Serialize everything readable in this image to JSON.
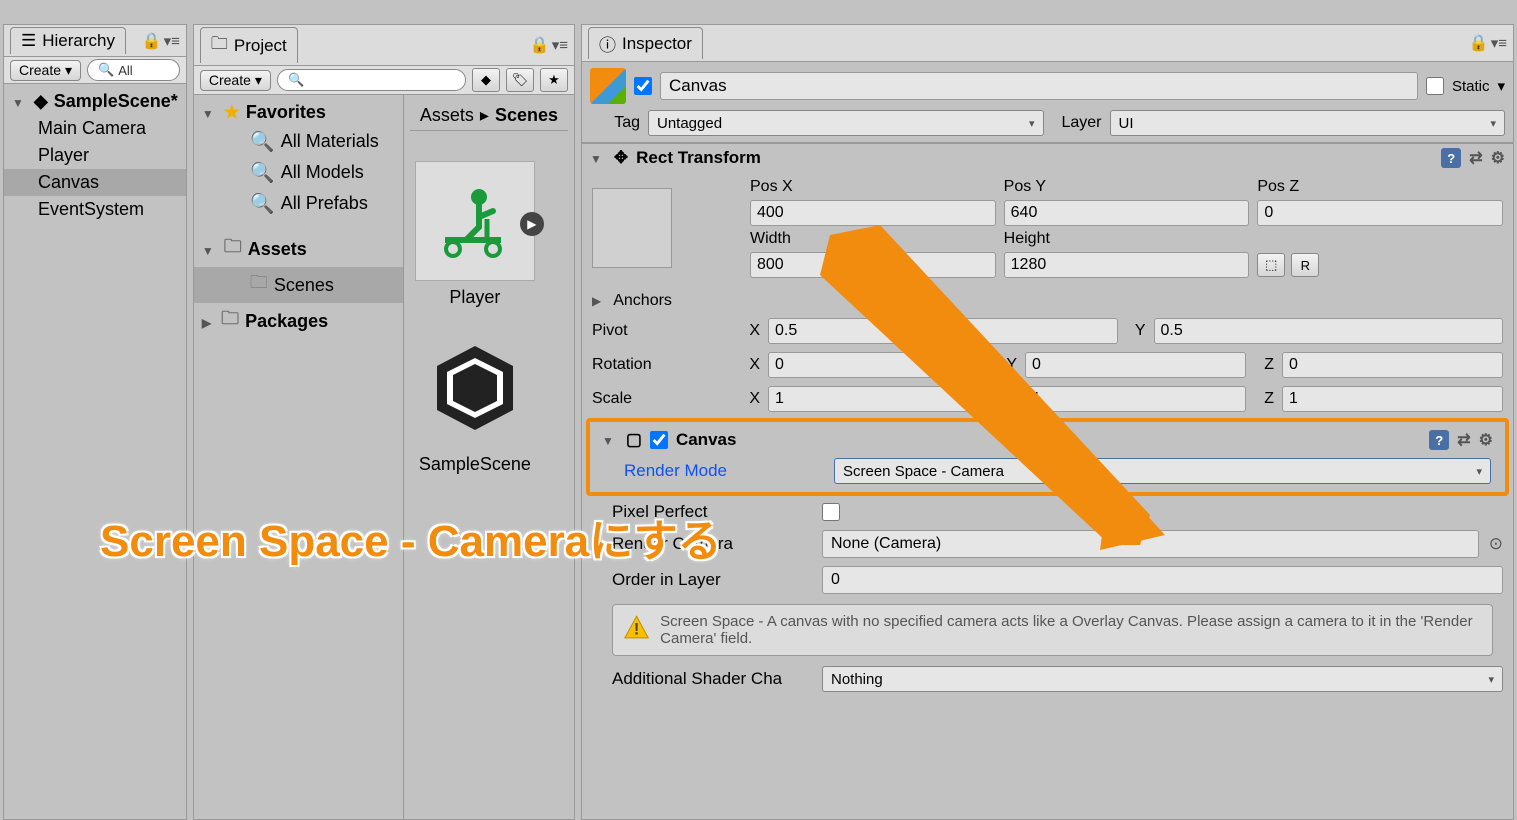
{
  "hierarchy": {
    "title": "Hierarchy",
    "create": "Create",
    "search": "All",
    "scene": "SampleScene*",
    "items": [
      "Main Camera",
      "Player",
      "Canvas",
      "EventSystem"
    ]
  },
  "project": {
    "title": "Project",
    "create": "Create",
    "favorites": "Favorites",
    "fav_items": [
      "All Materials",
      "All Models",
      "All Prefabs"
    ],
    "assets": "Assets",
    "scenes": "Scenes",
    "packages": "Packages",
    "crumb_root": "Assets",
    "crumb_active": "Scenes",
    "grid": [
      "Player",
      "SampleScene"
    ]
  },
  "inspector": {
    "title": "Inspector",
    "name": "Canvas",
    "static": "Static",
    "tag_label": "Tag",
    "tag_value": "Untagged",
    "layer_label": "Layer",
    "layer_value": "UI",
    "rect": {
      "title": "Rect Transform",
      "posx_l": "Pos X",
      "posy_l": "Pos Y",
      "posz_l": "Pos Z",
      "posx": "400",
      "posy": "640",
      "posz": "0",
      "w_l": "Width",
      "h_l": "Height",
      "w": "800",
      "h": "1280",
      "anchors": "Anchors",
      "pivot": "Pivot",
      "px": "0.5",
      "py": "0.5",
      "rotation": "Rotation",
      "rx": "0",
      "ry": "0",
      "rz": "0",
      "scale": "Scale",
      "sx": "1",
      "sy": "1",
      "sz": "1",
      "r_btn": "R"
    },
    "canvas": {
      "title": "Canvas",
      "render_mode_l": "Render Mode",
      "render_mode_v": "Screen Space - Camera",
      "pixel_perfect_l": "Pixel Perfect",
      "render_camera_l": "Render Camera",
      "render_camera_v": "None (Camera)",
      "order_l": "Order in Layer",
      "order_v": "0",
      "info": "Screen Space - A canvas with no specified camera acts like a Overlay Canvas. Please assign a camera to it in the 'Render Camera' field.",
      "shader_l": "Additional Shader Cha",
      "shader_v": "Nothing"
    }
  },
  "annotation": "Screen Space - Cameraにする"
}
